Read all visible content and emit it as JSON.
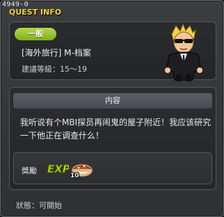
{
  "window": {
    "id_label": "4949-0",
    "title": "QUEST INFO"
  },
  "quest": {
    "category_badge": "一般",
    "name": "[海外旅行] M-档案",
    "level_requirement": "建議等級：15～19",
    "npc_icon": "agent-npc-portrait"
  },
  "content": {
    "header": "内容",
    "description": "我听说有个MBI探员再闹鬼的屋子附近！我应该研究一下他正在调查什么！"
  },
  "reward": {
    "label": "獎勵",
    "exp_label": "EXP",
    "item_icon": "food-item-icon",
    "item_quantity": "10"
  },
  "status": {
    "text": "狀態：可開始"
  },
  "colors": {
    "title": "#f2d63a",
    "badge_green": "#8fc02a",
    "exp_yellow": "#f4d21c"
  }
}
